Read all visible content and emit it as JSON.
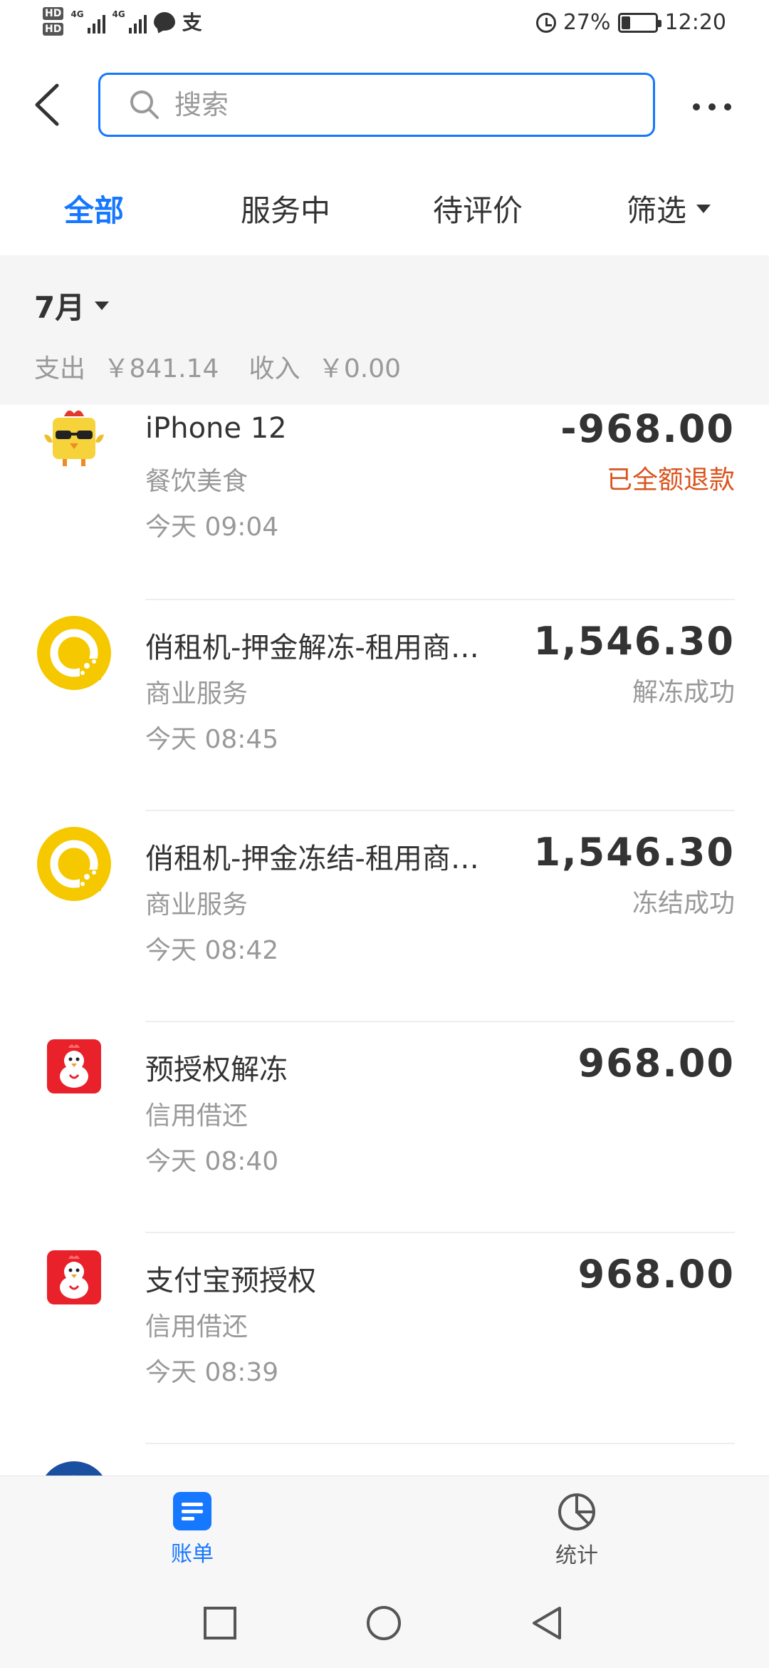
{
  "status_bar": {
    "hd1": "HD",
    "hd2": "HD",
    "net1": "4G",
    "net2": "4G",
    "pay_icon_glyph": "支",
    "battery_percent": "27%",
    "battery_level": 0.27,
    "time": "12:20"
  },
  "header": {
    "search_placeholder": "搜索"
  },
  "tabs": {
    "all": "全部",
    "in_service": "服务中",
    "to_review": "待评价",
    "filter": "筛选"
  },
  "month": {
    "label": "7月",
    "expense_label": "支出",
    "expense_value": "￥841.14",
    "income_label": "收入",
    "income_value": "￥0.00"
  },
  "transactions": [
    {
      "title": "iPhone 12",
      "category": "餐饮美食",
      "time": "今天  09:04",
      "amount": "-968.00",
      "status": "已全额退款",
      "icon": "chick-sunglasses-icon"
    },
    {
      "title": "俏租机-押金解冻-租用商…",
      "category": "商业服务",
      "time": "今天  08:45",
      "amount": "1,546.30",
      "status": "解冻成功",
      "icon": "yellow-circle-logo-icon"
    },
    {
      "title": "俏租机-押金冻结-租用商…",
      "category": "商业服务",
      "time": "今天  08:42",
      "amount": "1,546.30",
      "status": "冻结成功",
      "icon": "yellow-circle-logo-icon"
    },
    {
      "title": "预授权解冻",
      "category": "信用借还",
      "time": "今天  08:40",
      "amount": "968.00",
      "status": "",
      "icon": "red-chicken-logo-icon"
    },
    {
      "title": "支付宝预授权",
      "category": "信用借还",
      "time": "今天  08:39",
      "amount": "968.00",
      "status": "",
      "icon": "red-chicken-logo-icon"
    }
  ],
  "bottom_nav": {
    "bill": "账单",
    "stats": "统计"
  },
  "colors": {
    "accent": "#1677ff",
    "refund": "#d9541e",
    "muted": "#999999",
    "background_gray": "#f5f5f5"
  }
}
